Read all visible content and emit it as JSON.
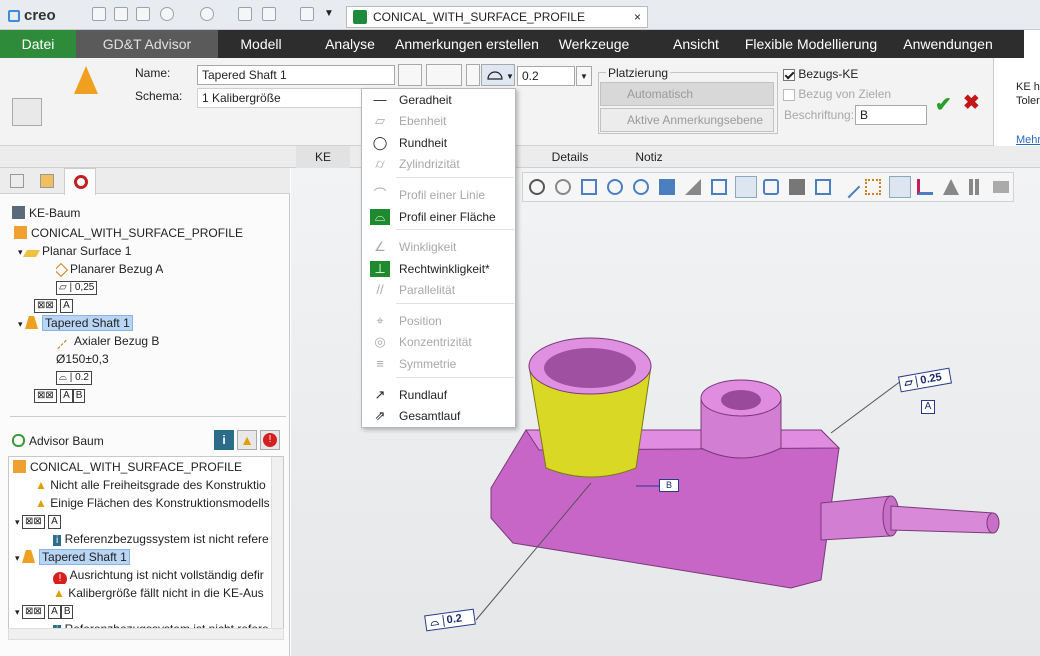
{
  "app": {
    "logo": "creo",
    "doc_title": "CONICAL_WITH_SURFACE_PROFILE"
  },
  "menu": [
    {
      "label": "Datei"
    },
    {
      "label": "GD&T Advisor"
    },
    {
      "label": "Modell"
    },
    {
      "label": "Analyse"
    },
    {
      "label": "Anmerkungen erstellen"
    },
    {
      "label": "Werkzeuge"
    },
    {
      "label": "Ansicht"
    },
    {
      "label": "Flexible Modellierung"
    },
    {
      "label": "Anwendungen"
    }
  ],
  "ribbon": {
    "name_label": "Name:",
    "name_value": "Tapered Shaft 1",
    "schema_label": "Schema:",
    "schema_value": "1 Kalibergröße",
    "tolerance_value": "0.2",
    "placement_title": "Platzierung",
    "auto_button": "Automatisch",
    "active_plane_button": "Aktive Anmerkungsebene",
    "bezugs_ke": "Bezugs-KE",
    "bezug_von_zielen": "Bezug von Zielen",
    "beschriftung_label": "Beschriftung:",
    "beschriftung_value": "B",
    "side_note": "KE hi\nToler",
    "more_link": "Mehr"
  },
  "subtabs": [
    {
      "label": "KE"
    },
    {
      "label": "Details"
    },
    {
      "label": "Notiz"
    }
  ],
  "dropdown": {
    "items": [
      {
        "label": "Geradheit",
        "enabled": true
      },
      {
        "label": "Ebenheit",
        "enabled": false
      },
      {
        "label": "Rundheit",
        "enabled": true
      },
      {
        "label": "Zylindrizität",
        "enabled": false
      },
      {
        "label": "Profil einer Linie",
        "enabled": false
      },
      {
        "label": "Profil einer Fläche",
        "enabled": true
      },
      {
        "label": "Winkligkeit",
        "enabled": false
      },
      {
        "label": "Rechtwinkligkeit*",
        "enabled": true
      },
      {
        "label": "Parallelität",
        "enabled": false
      },
      {
        "label": "Position",
        "enabled": false
      },
      {
        "label": "Konzentrizität",
        "enabled": false
      },
      {
        "label": "Symmetrie",
        "enabled": false
      },
      {
        "label": "Rundlauf",
        "enabled": true
      },
      {
        "label": "Gesamtlauf",
        "enabled": true
      }
    ]
  },
  "ke_tree": {
    "title": "KE-Baum",
    "rows": [
      {
        "label": "CONICAL_WITH_SURFACE_PROFILE"
      },
      {
        "label": "Planar Surface 1"
      },
      {
        "label": "Planarer Bezug A"
      },
      {
        "label": "0,25"
      },
      {
        "label": "A"
      },
      {
        "label": "Tapered Shaft 1"
      },
      {
        "label": "Axialer Bezug B"
      },
      {
        "label": "Ø150±0,3"
      },
      {
        "label": "0.2"
      },
      {
        "label": "A"
      },
      {
        "label": "B"
      }
    ]
  },
  "advisor_tree": {
    "title": "Advisor Baum",
    "rows": [
      {
        "label": "CONICAL_WITH_SURFACE_PROFILE"
      },
      {
        "label": "Nicht alle Freiheitsgrade des Konstruktio"
      },
      {
        "label": "Einige Flächen des Konstruktionsmodells"
      },
      {
        "label": "A"
      },
      {
        "label": "Referenzbezugssystem ist nicht refere"
      },
      {
        "label": "Tapered Shaft 1"
      },
      {
        "label": "Ausrichtung ist nicht vollständig defir"
      },
      {
        "label": "Kalibergröße fällt nicht in die KE-Aus"
      },
      {
        "label": "A"
      },
      {
        "label": "B"
      },
      {
        "label": "Referenzbezugssystem ist nicht refere"
      }
    ]
  },
  "annotations": {
    "fcf_top": "0.25",
    "datum_a": "A",
    "datum_b": "B",
    "fcf_bottom": "0.2"
  },
  "colors": {
    "accent_green": "#2e8b3a",
    "model_pink": "#d878d8",
    "cone_yellow": "#d9d825",
    "selection_blue": "#b8d5f5"
  }
}
